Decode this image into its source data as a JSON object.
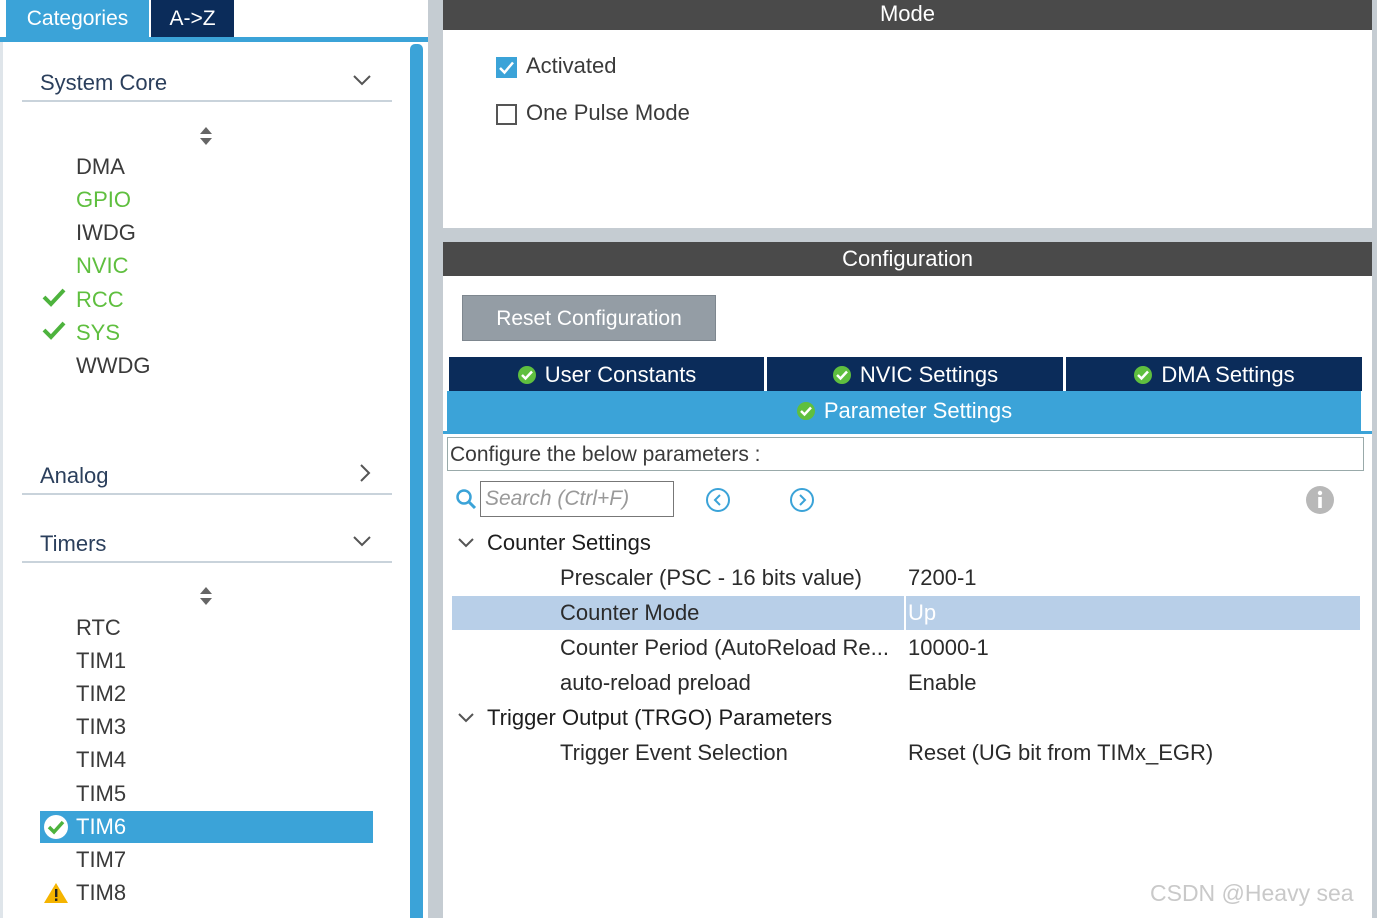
{
  "left_panel": {
    "tabs": [
      "Categories",
      "A->Z"
    ],
    "system_core": {
      "label": "System Core",
      "items": [
        {
          "label": "DMA",
          "status": "none"
        },
        {
          "label": "GPIO",
          "status": "configured"
        },
        {
          "label": "IWDG",
          "status": "none"
        },
        {
          "label": "NVIC",
          "status": "configured"
        },
        {
          "label": "RCC",
          "status": "checked"
        },
        {
          "label": "SYS",
          "status": "checked"
        },
        {
          "label": "WWDG",
          "status": "none"
        }
      ]
    },
    "analog": {
      "label": "Analog"
    },
    "timers": {
      "label": "Timers",
      "items": [
        {
          "label": "RTC"
        },
        {
          "label": "TIM1"
        },
        {
          "label": "TIM2"
        },
        {
          "label": "TIM3"
        },
        {
          "label": "TIM4"
        },
        {
          "label": "TIM5"
        },
        {
          "label": "TIM6",
          "selected": true
        },
        {
          "label": "TIM7"
        },
        {
          "label": "TIM8",
          "status": "warning"
        }
      ]
    }
  },
  "mode": {
    "title": "Mode",
    "activated_label": "Activated",
    "activated": true,
    "one_pulse_label": "One Pulse Mode",
    "one_pulse": false
  },
  "configuration": {
    "title": "Configuration",
    "reset_label": "Reset Configuration",
    "tabs": [
      "User Constants",
      "NVIC Settings",
      "DMA Settings"
    ],
    "active_tab": "Parameter Settings",
    "description": "Configure the below parameters :",
    "search_placeholder": "Search (Ctrl+F)",
    "groups": {
      "counter": {
        "label": "Counter Settings",
        "params": [
          {
            "name": "Prescaler (PSC - 16 bits value)",
            "value": "7200-1"
          },
          {
            "name": "Counter Mode",
            "value": "Up"
          },
          {
            "name": "Counter Period (AutoReload Re...",
            "value": "10000-1"
          },
          {
            "name": "auto-reload preload",
            "value": "Enable"
          }
        ]
      },
      "trigger": {
        "label": "Trigger Output (TRGO) Parameters",
        "params": [
          {
            "name": "Trigger Event Selection",
            "value": "Reset (UG bit from TIMx_EGR)"
          }
        ]
      }
    }
  },
  "colors": {
    "accent": "#3ba3d8",
    "navy": "#0b2c5a",
    "header": "#4a4a4a",
    "green": "#5fbf3f",
    "selected_row": "#b8cfe8"
  },
  "watermark": "CSDN @Heavy sea"
}
